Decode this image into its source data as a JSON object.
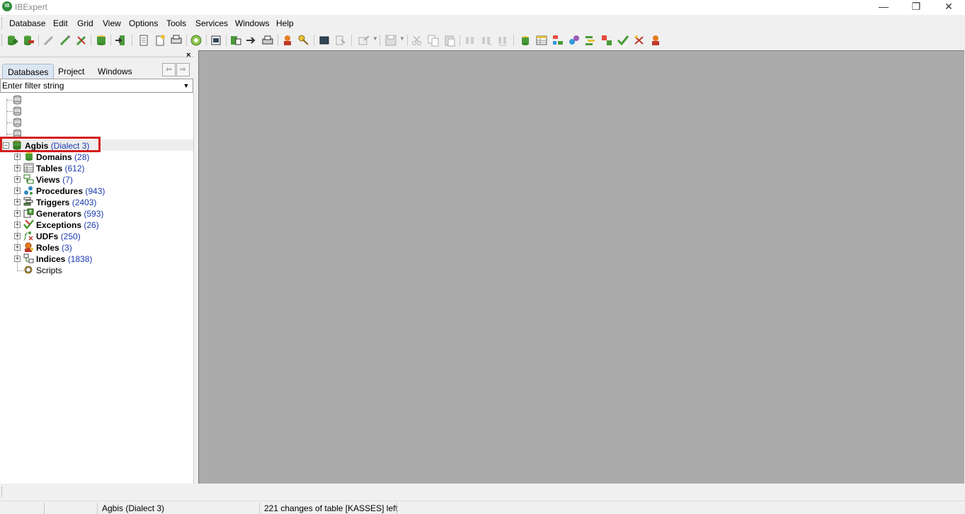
{
  "window": {
    "title": "IBExpert",
    "app_icon_text": "IB",
    "minimize_glyph": "—",
    "restore_glyph": "❐",
    "close_glyph": "✕"
  },
  "menu": [
    "Database",
    "Edit",
    "Grid",
    "View",
    "Options",
    "Tools",
    "Services",
    "Windows",
    "Help"
  ],
  "left_panel": {
    "close_glyph": "×",
    "tabs": [
      {
        "label": "Databases",
        "active": true
      },
      {
        "label": "Project",
        "active": false
      },
      {
        "label": "Windows",
        "active": false
      }
    ],
    "nav_left": "⇦",
    "nav_right": "⇨",
    "filter": {
      "placeholder": "Enter filter string",
      "value": "",
      "dropdown_glyph": "▼"
    }
  },
  "tree": {
    "database": {
      "name": "Agbis",
      "dialect": "(Dialect 3)",
      "expander": "−"
    },
    "nodes": [
      {
        "label": "Domains",
        "count": "(28)",
        "icon": "domain-icon",
        "bold": true
      },
      {
        "label": "Tables",
        "count": "(612)",
        "icon": "table-icon",
        "bold": true
      },
      {
        "label": "Views",
        "count": "(7)",
        "icon": "view-icon",
        "bold": true
      },
      {
        "label": "Procedures",
        "count": "(943)",
        "icon": "procedure-icon",
        "bold": true
      },
      {
        "label": "Triggers",
        "count": "(2403)",
        "icon": "trigger-icon",
        "bold": true
      },
      {
        "label": "Generators",
        "count": "(593)",
        "icon": "generator-icon",
        "bold": true
      },
      {
        "label": "Exceptions",
        "count": "(26)",
        "icon": "exception-icon",
        "bold": true
      },
      {
        "label": "UDFs",
        "count": "(250)",
        "icon": "udf-icon",
        "bold": true
      },
      {
        "label": "Roles",
        "count": "(3)",
        "icon": "role-icon",
        "bold": true
      },
      {
        "label": "Indices",
        "count": "(1838)",
        "icon": "index-icon",
        "bold": true
      },
      {
        "label": "Scripts",
        "count": "",
        "icon": "script-icon",
        "bold": false
      }
    ],
    "expander_glyph": "+"
  },
  "status": {
    "database": "Agbis (Dialect 3)",
    "message": "221 changes of table [KASSES] left"
  },
  "colors": {
    "mdi_background": "#ababab",
    "highlight_border": "#d41c1c",
    "count_text": "#1a3ab0"
  }
}
